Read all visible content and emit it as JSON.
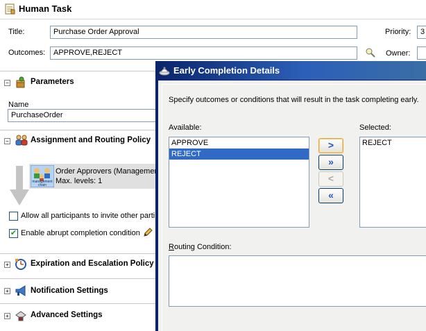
{
  "human_task": {
    "title": "Human Task",
    "title_label": "Title:",
    "title_value": "Purchase Order Approval",
    "priority_label": "Priority:",
    "priority_value": "3",
    "outcomes_label": "Outcomes:",
    "outcomes_value": "APPROVE,REJECT",
    "owner_label": "Owner:"
  },
  "parameters": {
    "header": "Parameters",
    "name_label": "Name",
    "name_value": "PurchaseOrder"
  },
  "assignment": {
    "header": "Assignment and Routing Policy",
    "participant_title": "Order Approvers (Managemen",
    "participant_levels": "Max. levels: 1",
    "participant_icon_text": "management chain",
    "allow_invite_label": "Allow all participants to invite other parti",
    "abrupt_label": "Enable abrupt completion condition"
  },
  "sections": {
    "expiration": "Expiration and Escalation Policy",
    "notification": "Notification Settings",
    "advanced": "Advanced Settings"
  },
  "dialog": {
    "title": "Early Completion Details",
    "description": "Specify outcomes or conditions that will result in the task completing early.",
    "available_label": "Available:",
    "selected_label": "Selected:",
    "available_items": [
      "APPROVE",
      "REJECT"
    ],
    "selected_items": [
      "REJECT"
    ],
    "routing_label_underlined": "R",
    "routing_label_rest": "outing Condition:",
    "btn_move": ">",
    "btn_move_all": "»",
    "btn_remove": "<",
    "btn_remove_all": "«"
  },
  "colors": {
    "dialog_title_bar": "#0a246a",
    "selection": "#316ac5"
  }
}
